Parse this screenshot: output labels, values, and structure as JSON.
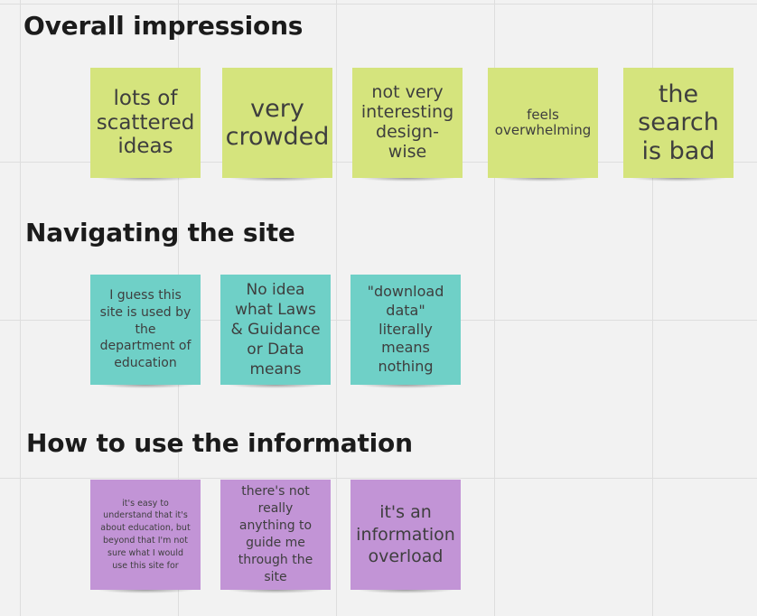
{
  "board": {
    "sections": [
      {
        "title": "Overall impressions",
        "notes": [
          "lots of scattered ideas",
          "very crowded",
          "not very interesting design-wise",
          "feels overwhelming",
          "the search is bad"
        ]
      },
      {
        "title": "Navigating the site",
        "notes": [
          "I guess this site is used by the department of education",
          "No idea what Laws & Guidance or Data means",
          "\"download data\" literally means nothing"
        ]
      },
      {
        "title": "How to use the information",
        "notes": [
          "it's easy to understand that it's about education, but beyond that I'm not sure what I would use this site for",
          "there's not really anything to guide me through the site",
          "it's an information overload"
        ]
      }
    ]
  },
  "colors": {
    "section_1_notes": "#d5e47d",
    "section_2_notes": "#6fd0c7",
    "section_3_notes": "#c294d6"
  }
}
